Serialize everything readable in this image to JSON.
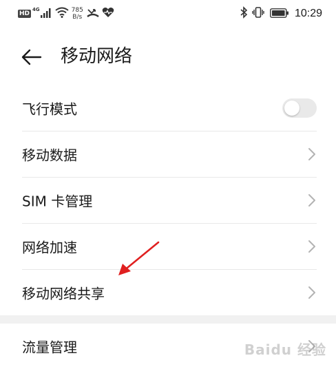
{
  "status_bar": {
    "hd": "HD",
    "network_type": "4G",
    "speed_value": "785",
    "speed_unit": "B/s",
    "time": "10:29"
  },
  "header": {
    "title": "移动网络"
  },
  "settings": {
    "items": [
      {
        "label": "飞行模式",
        "control": "toggle",
        "toggle_on": false
      },
      {
        "label": "移动数据",
        "control": "chevron"
      },
      {
        "label": "SIM 卡管理",
        "control": "chevron"
      },
      {
        "label": "网络加速",
        "control": "chevron"
      },
      {
        "label": "移动网络共享",
        "control": "chevron"
      }
    ],
    "items_section2": [
      {
        "label": "流量管理",
        "control": "chevron"
      }
    ]
  },
  "annotation": {
    "arrow_color": "#e02020",
    "points_to": "移动网络共享"
  },
  "watermark": {
    "text": "Baidu 经验"
  },
  "icons": {
    "signal": "signal-icon",
    "wifi": "wifi-icon",
    "missed_call": "missed-call-icon",
    "health": "heart-rate-icon",
    "bluetooth": "bluetooth-icon",
    "vibrate": "vibrate-icon",
    "battery": "battery-icon",
    "back": "back-arrow-icon",
    "chevron": "chevron-right-icon"
  },
  "colors": {
    "text": "#1a1a1a",
    "divider": "#e8e8e8",
    "toggle_off": "#e9e9e9",
    "chevron": "#b3b3b3"
  }
}
